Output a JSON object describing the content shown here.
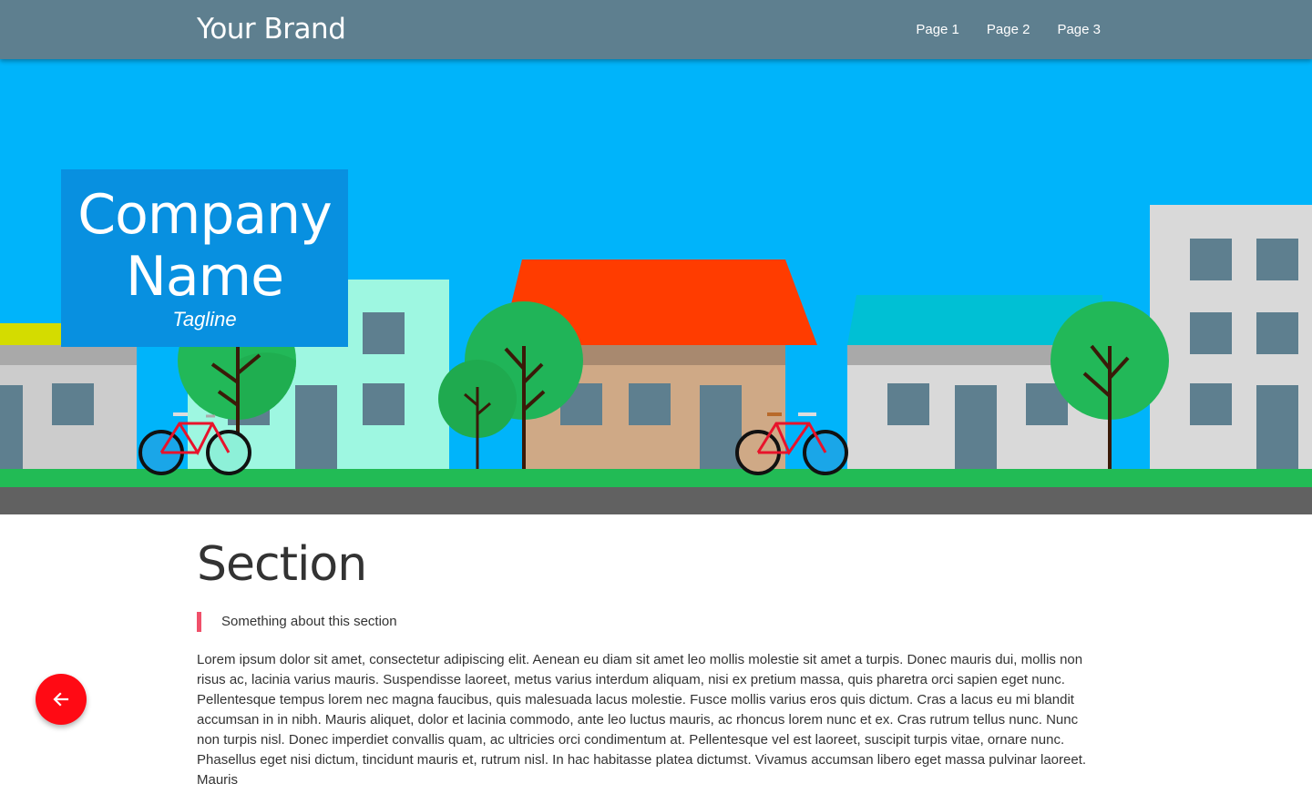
{
  "header": {
    "brand": "Your Brand",
    "nav": [
      "Page 1",
      "Page 2",
      "Page 3"
    ]
  },
  "hero": {
    "company_name": "Company Name",
    "tagline": "Tagline"
  },
  "section": {
    "title": "Section",
    "quote": "Something about this section",
    "body": "Lorem ipsum dolor sit amet, consectetur adipiscing elit. Aenean eu diam sit amet leo mollis molestie sit amet a turpis. Donec mauris dui, mollis non risus ac, lacinia varius mauris. Suspendisse laoreet, metus varius interdum aliquam, nisi ex pretium massa, quis pharetra orci sapien eget nunc. Pellentesque tempus lorem nec magna faucibus, quis malesuada lacus molestie. Fusce mollis varius eros quis dictum. Cras a lacus eu mi blandit accumsan in in nibh. Mauris aliquet, dolor et lacinia commodo, ante leo luctus mauris, ac rhoncus lorem nunc et ex. Cras rutrum tellus nunc. Nunc non turpis nisl. Donec imperdiet convallis quam, ac ultricies orci condimentum at. Pellentesque vel est laoreet, suscipit turpis vitae, ornare nunc. Phasellus eget nisi dictum, tincidunt mauris et, rutrum nisl. In hac habitasse platea dictumst. Vivamus accumsan libero eget massa pulvinar laoreet. Mauris"
  },
  "fab": {
    "icon": "arrow-left-icon"
  },
  "colors": {
    "topbar": "#5e7f8f",
    "sky": "#00b4fa",
    "title_box": "#0890e0",
    "accent": "#f0506a",
    "fab": "#ff0a14"
  }
}
